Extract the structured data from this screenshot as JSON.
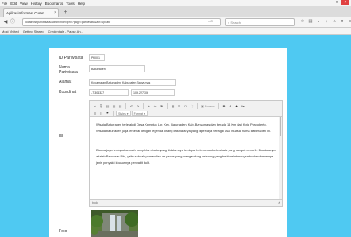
{
  "browser": {
    "menu": [
      "File",
      "Edit",
      "View",
      "History",
      "Bookmarks",
      "Tools",
      "Help"
    ],
    "tab_title": "AplikasiInformasi Curan...",
    "new_tab": "+",
    "url": "localhost/pariwisata/admin/index.php?page=pariwisata&act=update",
    "search_placeholder": "Search",
    "bookmarks": [
      "Most Visited",
      "Getting Started",
      "Credentials - Pause An..."
    ]
  },
  "form": {
    "labels": {
      "id": "ID Pariwisata",
      "nama": "Nama Pariwisata",
      "alamat": "Alamat",
      "koordinat": "Koordinat",
      "isi": "Isi",
      "foto": "Foto"
    },
    "values": {
      "id": "PR001",
      "nama": "Baturraden",
      "alamat": "Kecamatan Baturraden, Kabupaten Banyumas",
      "lat": "-7.306327",
      "lng": "109.227306"
    }
  },
  "editor": {
    "toolbar_row1": [
      "✂",
      "⎘",
      "▤",
      "▤",
      "▤",
      "↶",
      "↷",
      "⚭",
      "⚯",
      "⚑",
      "▦",
      "☷",
      "Ω",
      "⛶"
    ],
    "source_label": "Source",
    "format_row1": [
      "B",
      "I",
      "S",
      "Ix"
    ],
    "toolbar_row2": [
      "☰",
      "☷",
      "❞"
    ],
    "styles_label": "Styles",
    "format_label": "Format",
    "paragraph1": "Wisata Baturraden terletak di Desa Kemutuk Lor, Kec. Baturraden, Kab. Banyumas dan berada 14 Km dari Kota Purwokerto. Wisata baturraden juga terkenal dengan legenda kisang kasmaranya yang dipercaya sebagai asal muasal nama Baturraden ini.",
    "paragraph2": "Disana juga terdapat sebuah kompleks wisata yang didalamnya terdapat beberapa objek wisata yang sangat menarik. Diantaranya adalah Pancuran Pitu, yaitu sebuah pemandian air panas yang mengandung belerang yang berkhasiat menyembuhkan beberapa jenis penyakit khususnya penyakit kulit.",
    "status": "body"
  }
}
